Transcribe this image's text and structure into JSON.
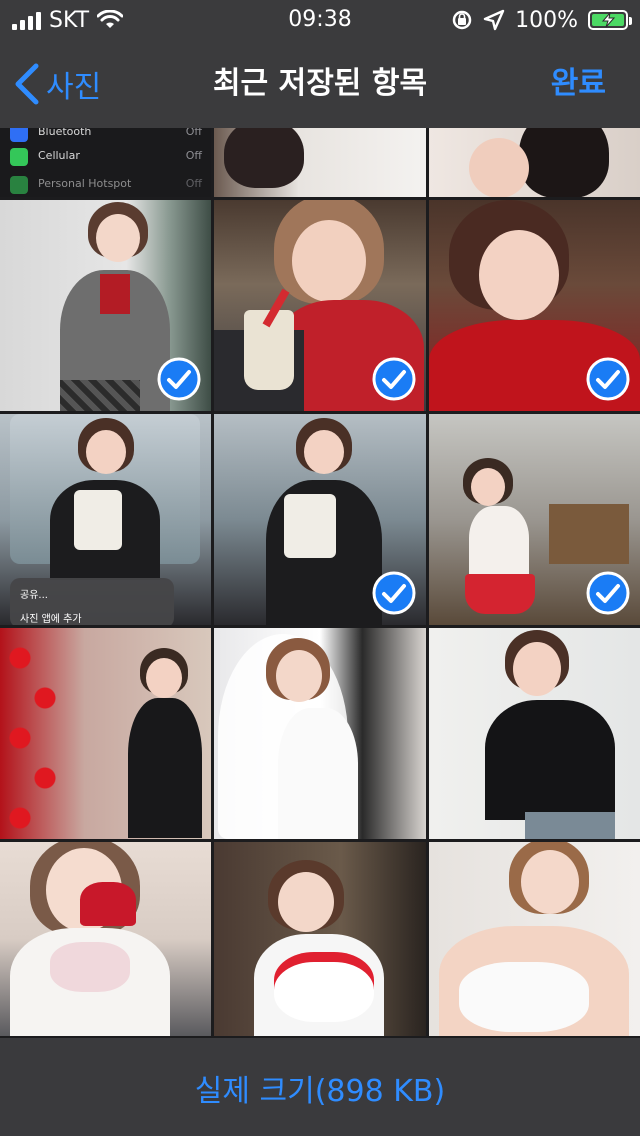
{
  "status_bar": {
    "carrier": "SKT",
    "time": "09:38",
    "battery": "100%"
  },
  "nav": {
    "back_label": "사진",
    "title": "최근 저장된 항목",
    "done_label": "완료"
  },
  "thumbnail_texts": {
    "settings_rows": [
      {
        "label": "Bluetooth",
        "value": "Off"
      },
      {
        "label": "Cellular",
        "value": "Off"
      },
      {
        "label": "Personal Hotspot",
        "value": "Off"
      }
    ],
    "context_menu": [
      "공유...",
      "사진 앱에 추가"
    ]
  },
  "photos": [
    {
      "name": "photo-1",
      "selected": false
    },
    {
      "name": "photo-2",
      "selected": false
    },
    {
      "name": "photo-3",
      "selected": false
    },
    {
      "name": "photo-4",
      "selected": true
    },
    {
      "name": "photo-5",
      "selected": true
    },
    {
      "name": "photo-6",
      "selected": true
    },
    {
      "name": "photo-7",
      "selected": false
    },
    {
      "name": "photo-8",
      "selected": true
    },
    {
      "name": "photo-9",
      "selected": true
    },
    {
      "name": "photo-10",
      "selected": false
    },
    {
      "name": "photo-11",
      "selected": false
    },
    {
      "name": "photo-12",
      "selected": false
    },
    {
      "name": "photo-13",
      "selected": false
    },
    {
      "name": "photo-14",
      "selected": false
    },
    {
      "name": "photo-15",
      "selected": false
    }
  ],
  "toolbar": {
    "actual_size_label": "실제 크기(898 KB)"
  },
  "colors": {
    "accent": "#2f8cff",
    "check_fill": "#1a7cf5",
    "bar_bg": "#3c3c3e"
  }
}
